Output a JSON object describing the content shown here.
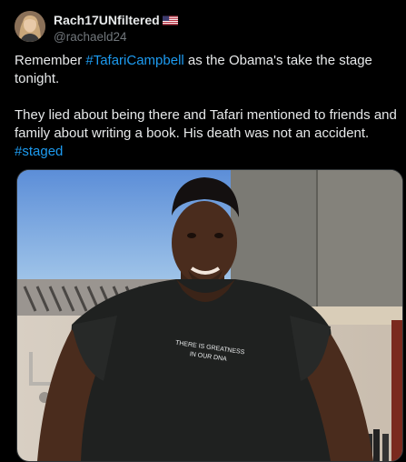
{
  "author": {
    "display_name": "Rach17UNfiltered",
    "handle": "@rachaeld24",
    "avatar_icon": "user-avatar",
    "badge_icon": "us-flag-icon"
  },
  "tweet": {
    "line1_before": "Remember ",
    "hashtag1": "#TafariCampbell",
    "line1_after": " as the Obama's take the stage tonight.",
    "paragraph2": "They lied about being there and Tafari mentioned to friends and family about writing a book. His death was not an accident.",
    "hashtag2": "#staged"
  },
  "media": {
    "shirt_text_line1": "THERE IS GREATNESS",
    "shirt_text_line2": "IN OUR DNA"
  },
  "colors": {
    "background": "#000000",
    "text": "#e7e9ea",
    "secondary_text": "#71767b",
    "link": "#1d9bf0"
  }
}
